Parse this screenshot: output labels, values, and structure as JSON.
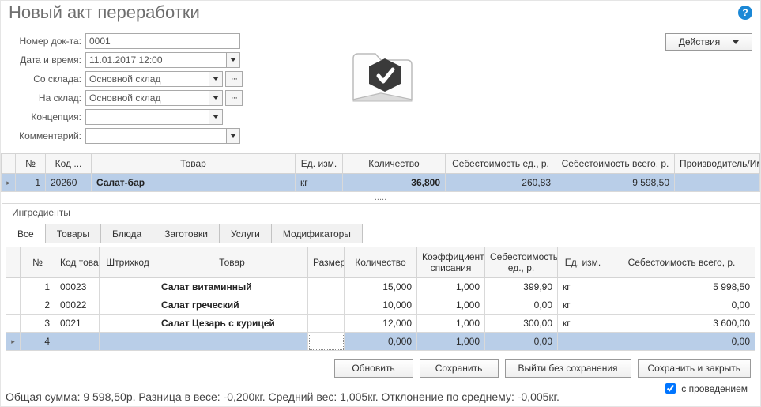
{
  "title": "Новый акт переработки",
  "actions_label": "Действия",
  "form": {
    "labels": {
      "doc_no": "Номер док-та:",
      "datetime": "Дата и время:",
      "from_wh": "Со склада:",
      "to_wh": "На склад:",
      "concept": "Концепция:",
      "comment": "Комментарий:"
    },
    "values": {
      "doc_no": "0001",
      "datetime": "11.01.2017 12:00",
      "from_wh": "Основной склад",
      "to_wh": "Основной склад",
      "concept": "",
      "comment": ""
    }
  },
  "main_table": {
    "headers": {
      "handle": "",
      "num": "№",
      "code": "Код ...",
      "product": "Товар",
      "unit": "Ед. изм.",
      "qty": "Количество",
      "unit_cost": "Себестоимость ед., р.",
      "total_cost": "Себестоимость всего, р.",
      "producer": "Производитель/Им..."
    },
    "rows": [
      {
        "handle": "▸",
        "num": "1",
        "code": "20260",
        "product": "Салат-бар",
        "unit": "кг",
        "qty": "36,800",
        "unit_cost": "260,83",
        "total_cost": "9 598,50",
        "producer": ""
      }
    ],
    "dots": "....."
  },
  "ingredients": {
    "legend": "Ингредиенты",
    "tabs": [
      "Все",
      "Товары",
      "Блюда",
      "Заготовки",
      "Услуги",
      "Модификаторы"
    ],
    "headers": {
      "handle": "",
      "num": "№",
      "code": "Код товара",
      "barcode": "Штрихкод",
      "product": "Товар",
      "size": "Размер",
      "qty": "Количество",
      "coef": "Коэффициент списания",
      "unit_cost": "Себестоимость ед., р.",
      "unit": "Ед. изм.",
      "total_cost": "Себестоимость всего, р."
    },
    "rows": [
      {
        "handle": "",
        "num": "1",
        "code": "00023",
        "barcode": "",
        "product": "Салат витаминный",
        "size": "",
        "qty": "15,000",
        "coef": "1,000",
        "unit_cost": "399,90",
        "unit": "кг",
        "total_cost": "5 998,50"
      },
      {
        "handle": "",
        "num": "2",
        "code": "00022",
        "barcode": "",
        "product": "Салат греческий",
        "size": "",
        "qty": "10,000",
        "coef": "1,000",
        "unit_cost": "0,00",
        "unit": "кг",
        "total_cost": "0,00"
      },
      {
        "handle": "",
        "num": "3",
        "code": "0021",
        "barcode": "",
        "product": "Салат Цезарь с курицей",
        "size": "",
        "qty": "12,000",
        "coef": "1,000",
        "unit_cost": "300,00",
        "unit": "кг",
        "total_cost": "3 600,00"
      },
      {
        "handle": "▸",
        "num": "4",
        "code": "",
        "barcode": "",
        "product": "",
        "size": "",
        "qty": "0,000",
        "coef": "1,000",
        "unit_cost": "0,00",
        "unit": "",
        "total_cost": "0,00"
      }
    ]
  },
  "buttons": {
    "refresh": "Обновить",
    "save": "Сохранить",
    "exit": "Выйти без сохранения",
    "save_close": "Сохранить и закрыть"
  },
  "checkbox": {
    "label": "с проведением",
    "checked": true
  },
  "status": "Общая сумма: 9 598,50р. Разница в весе: -0,200кг.   Средний вес: 1,005кг.   Отклонение по среднему: -0,005кг."
}
